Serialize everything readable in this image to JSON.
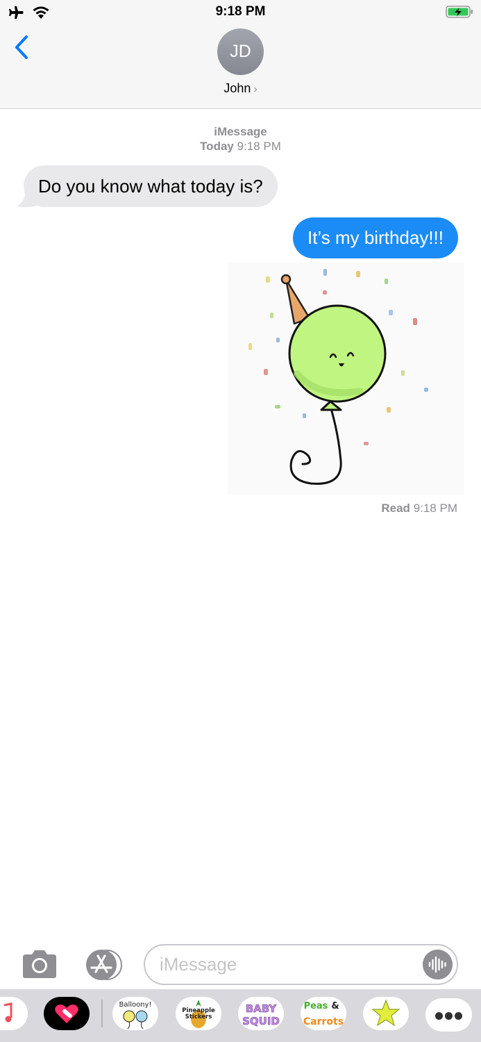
{
  "status_bar": {
    "time": "9:18 PM"
  },
  "header": {
    "avatar_initials": "JD",
    "contact_name": "John"
  },
  "thread": {
    "service": "iMessage",
    "day": "Today",
    "time": "9:18 PM",
    "messages": [
      {
        "direction": "incoming",
        "text": "Do you know what today is?"
      },
      {
        "direction": "outgoing",
        "text": "It’s my birthday!!!"
      },
      {
        "direction": "outgoing",
        "type": "sticker",
        "sticker": "party-balloon-sticker"
      }
    ],
    "read_label": "Read",
    "read_time": "9:18 PM"
  },
  "input": {
    "placeholder": "iMessage"
  },
  "colors": {
    "outgoing_bubble": "#1b8cf5",
    "incoming_bubble": "#e9e9eb",
    "accent": "#007aff"
  },
  "apps": {
    "balloony_text": "Balloony!",
    "pineapple_text_1": "Pineapple",
    "pineapple_text_2": "Stickers",
    "babysquid_text_1": "BABY",
    "babysquid_text_2": "SQUID",
    "peas_text_1": "Peas",
    "peas_text_2": "&",
    "peas_text_3": "Carrots"
  }
}
